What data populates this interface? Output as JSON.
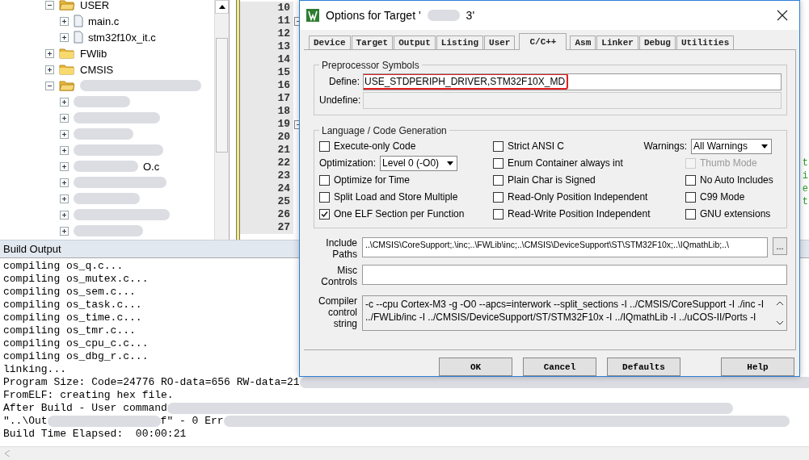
{
  "project_tree": {
    "items": [
      {
        "kind": "folder",
        "label": "USER",
        "expanded": true,
        "children": [
          {
            "kind": "file",
            "label": "main.c"
          },
          {
            "kind": "file",
            "label": "stm32f10x_it.c"
          }
        ]
      },
      {
        "kind": "folder",
        "label": "FWlib",
        "expanded": false
      },
      {
        "kind": "folder",
        "label": "CMSIS",
        "expanded": false
      },
      {
        "kind": "redacted",
        "expanded": true,
        "children": [
          {
            "kind": "redacted"
          },
          {
            "kind": "redacted"
          },
          {
            "kind": "redacted"
          },
          {
            "kind": "redacted"
          },
          {
            "kind": "redacted",
            "tail": "O.c"
          },
          {
            "kind": "redacted"
          },
          {
            "kind": "redacted"
          },
          {
            "kind": "redacted"
          },
          {
            "kind": "redacted"
          }
        ]
      }
    ]
  },
  "editor": {
    "lines": [
      {
        "number": "10",
        "fold": false
      },
      {
        "number": "11",
        "fold": true
      },
      {
        "number": "12",
        "fold": false
      },
      {
        "number": "13",
        "fold": false
      },
      {
        "number": "14",
        "fold": false
      },
      {
        "number": "15",
        "fold": false
      },
      {
        "number": "16",
        "fold": false
      },
      {
        "number": "17",
        "fold": false
      },
      {
        "number": "18",
        "fold": false
      },
      {
        "number": "19",
        "fold": true
      },
      {
        "number": "20",
        "fold": false
      },
      {
        "number": "21",
        "fold": false
      },
      {
        "number": "22",
        "fold": false,
        "code": "t"
      },
      {
        "number": "23",
        "fold": false,
        "code": "i"
      },
      {
        "number": "24",
        "fold": false,
        "code": "e"
      },
      {
        "number": "25",
        "fold": false,
        "code": "t"
      },
      {
        "number": "26",
        "fold": false
      },
      {
        "number": "27",
        "fold": false
      }
    ]
  },
  "build_output": {
    "title": "Build Output",
    "lines": [
      [
        {
          "kind": "text",
          "text": "compiling os_q.c..."
        }
      ],
      [
        {
          "kind": "text",
          "text": "compiling os_mutex.c..."
        }
      ],
      [
        {
          "kind": "text",
          "text": "compiling os_sem.c..."
        }
      ],
      [
        {
          "kind": "text",
          "text": "compiling os_task.c..."
        }
      ],
      [
        {
          "kind": "text",
          "text": "compiling os_time.c..."
        }
      ],
      [
        {
          "kind": "text",
          "text": "compiling os_tmr.c..."
        }
      ],
      [
        {
          "kind": "text",
          "text": "compiling os_cpu_c.c..."
        }
      ],
      [
        {
          "kind": "text",
          "text": "compiling os_dbg_r.c..."
        }
      ],
      [
        {
          "kind": "text",
          "text": "linking..."
        }
      ],
      [
        {
          "kind": "text",
          "text": "Program Size: Code=24776 RO-data=656 RW-data=21"
        },
        {
          "kind": "redacted"
        }
      ],
      [
        {
          "kind": "text",
          "text": "FromELF: creating hex file."
        }
      ],
      [
        {
          "kind": "text",
          "text": "After Build - User command"
        },
        {
          "kind": "redacted"
        }
      ],
      [
        {
          "kind": "text",
          "text": "\"..\\Out"
        },
        {
          "kind": "redacted"
        },
        {
          "kind": "text",
          "text": "f\" - 0 Err"
        },
        {
          "kind": "redacted"
        }
      ],
      [
        {
          "kind": "text",
          "text": "Build Time Elapsed:  00:00:21"
        }
      ]
    ]
  },
  "dialog": {
    "title": "Options for Target '",
    "title_end": "3'",
    "tabs": [
      {
        "label": "Device",
        "selected": false
      },
      {
        "label": "Target",
        "selected": false
      },
      {
        "label": "Output",
        "selected": false
      },
      {
        "label": "Listing",
        "selected": false
      },
      {
        "label": "User",
        "selected": false
      },
      {
        "label": "C/C++",
        "selected": true
      },
      {
        "label": "Asm",
        "selected": false
      },
      {
        "label": "Linker",
        "selected": false
      },
      {
        "label": "Debug",
        "selected": false
      },
      {
        "label": "Utilities",
        "selected": false
      }
    ],
    "preprocessor": {
      "title": "Preprocessor Symbols",
      "define_label": "Define:",
      "define_value": "USE_STDPERIPH_DRIVER,STM32F10X_MD",
      "define_highlighted": true,
      "undefine_label": "Undefine:"
    },
    "language": {
      "title": "Language / Code Generation",
      "columns": [
        [
          {
            "kind": "checkbox",
            "label": "Execute-only Code",
            "checked": false,
            "disabled": false
          },
          {
            "kind": "dropdown",
            "label": "Optimization:",
            "value": "Level 0 (-O0)"
          },
          {
            "kind": "checkbox",
            "label": "Optimize for Time",
            "checked": false,
            "disabled": false
          },
          {
            "kind": "checkbox",
            "label": "Split Load and Store Multiple",
            "checked": false,
            "disabled": false
          },
          {
            "kind": "checkbox",
            "label": "One ELF Section per Function",
            "checked": true,
            "disabled": false
          }
        ],
        [
          {
            "kind": "checkbox",
            "label": "Strict ANSI C",
            "checked": false,
            "disabled": false
          },
          {
            "kind": "checkbox",
            "label": "Enum Container always int",
            "checked": false,
            "disabled": false
          },
          {
            "kind": "checkbox",
            "label": "Plain Char is Signed",
            "checked": false,
            "disabled": false
          },
          {
            "kind": "checkbox",
            "label": "Read-Only Position Independent",
            "checked": false,
            "disabled": false
          },
          {
            "kind": "checkbox",
            "label": "Read-Write Position Independent",
            "checked": false,
            "disabled": false
          }
        ],
        [
          {
            "kind": "dropdown",
            "label": "Warnings:",
            "value": "All Warnings"
          },
          {
            "kind": "checkbox",
            "label": "Thumb Mode",
            "checked": false,
            "disabled": true
          },
          {
            "kind": "checkbox",
            "label": "No Auto Includes",
            "checked": false,
            "disabled": false
          },
          {
            "kind": "checkbox",
            "label": "C99 Mode",
            "checked": false,
            "disabled": false
          },
          {
            "kind": "checkbox",
            "label": "GNU extensions",
            "checked": false,
            "disabled": false
          }
        ]
      ]
    },
    "include_paths": {
      "label": "Include Paths",
      "value": "..\\CMSIS\\CoreSupport;.\\inc;..\\FWLib\\inc;..\\CMSIS\\DeviceSupport\\ST\\STM32F10x;..\\IQmathLib;..\\",
      "browse": "..."
    },
    "misc_controls": {
      "label": "Misc Controls"
    },
    "compiler_string": {
      "label": "Compiler control string",
      "lines": [
        "-c --cpu Cortex-M3 -g -O0 --apcs=interwork --split_sections -I ../CMSIS/CoreSupport -I ./inc -I",
        "../FWLib/inc -I ../CMSIS/DeviceSupport/ST/STM32F10x -I ../IQmathLib -I ../uCOS-II/Ports -I"
      ]
    },
    "buttons": [
      "OK",
      "Cancel",
      "Defaults",
      "Help"
    ]
  }
}
